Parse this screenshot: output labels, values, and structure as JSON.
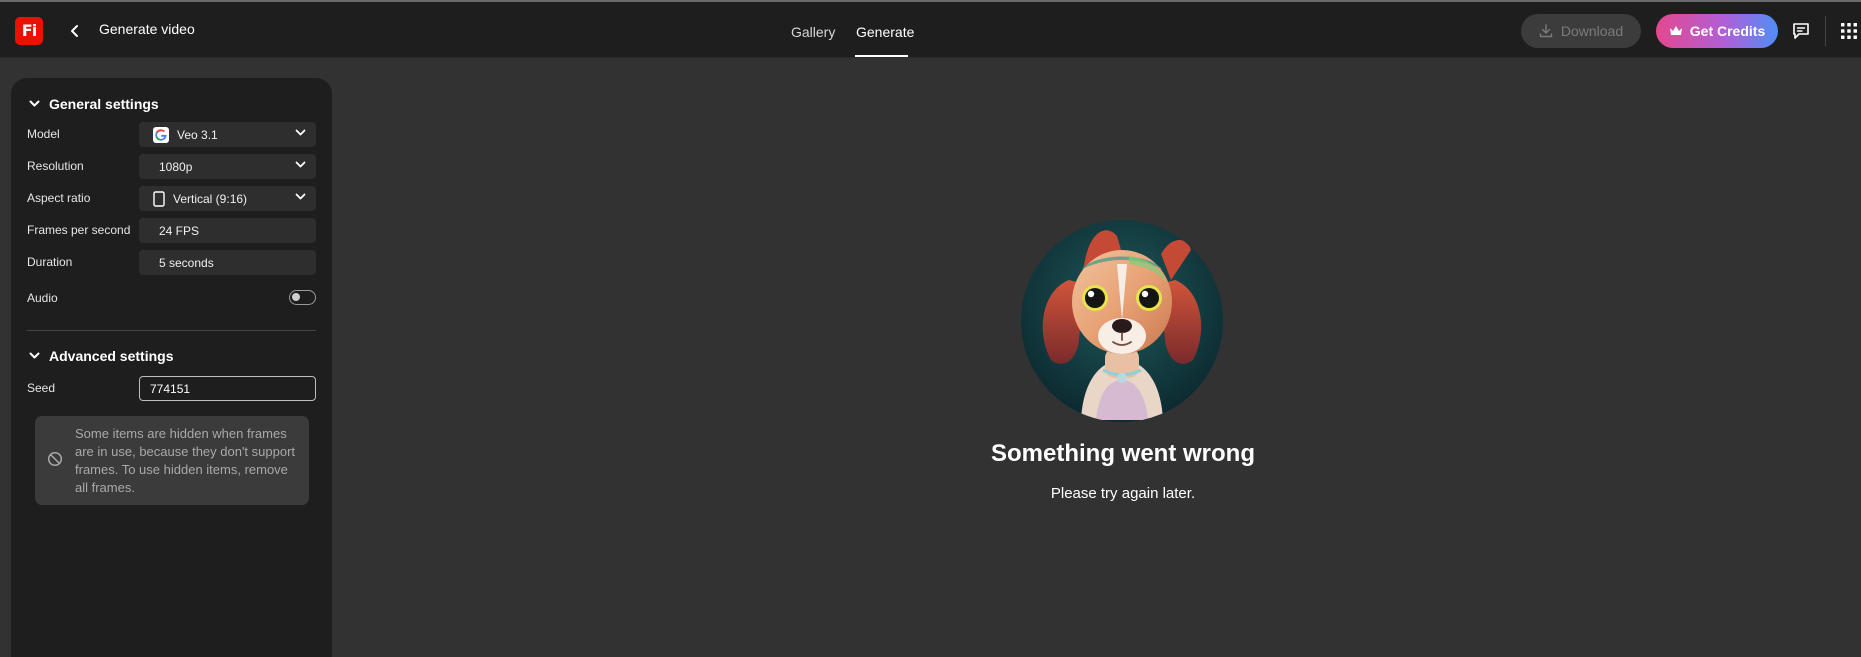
{
  "app": {
    "logo_text": "Fi",
    "page_title": "Generate video"
  },
  "nav": {
    "tabs": [
      {
        "label": "Gallery"
      },
      {
        "label": "Generate"
      }
    ],
    "active_tab": "Generate"
  },
  "toolbar": {
    "download_label": "Download",
    "credits_label": "Get Credits",
    "icons": [
      "download-icon",
      "crown-icon",
      "chat-icon",
      "apps-grid-icon"
    ]
  },
  "general_settings": {
    "title": "General settings",
    "model": {
      "label": "Model",
      "value": "Veo 3.1",
      "icon": "google-icon"
    },
    "resolution": {
      "label": "Resolution",
      "value": "1080p"
    },
    "aspect_ratio": {
      "label": "Aspect ratio",
      "value": "Vertical (9:16)",
      "icon": "portrait-frame-icon"
    },
    "fps": {
      "label": "Frames per second",
      "value": "24 FPS"
    },
    "duration": {
      "label": "Duration",
      "value": "5 seconds"
    },
    "audio": {
      "label": "Audio",
      "enabled": false
    }
  },
  "advanced_settings": {
    "title": "Advanced settings",
    "seed": {
      "label": "Seed",
      "value": "774151"
    }
  },
  "notice": {
    "text": "Some items are hidden when frames are in use, because they don't support frames. To use hidden items, remove all frames.",
    "icon": "block-icon"
  },
  "error": {
    "title": "Something went wrong",
    "message": "Please try again later."
  },
  "colors": {
    "accent_red": "#eb1000",
    "credits_gradient_start": "#e3488e",
    "credits_gradient_end": "#4f8ef7",
    "background": "#323232",
    "panel": "#1e1e1e"
  }
}
